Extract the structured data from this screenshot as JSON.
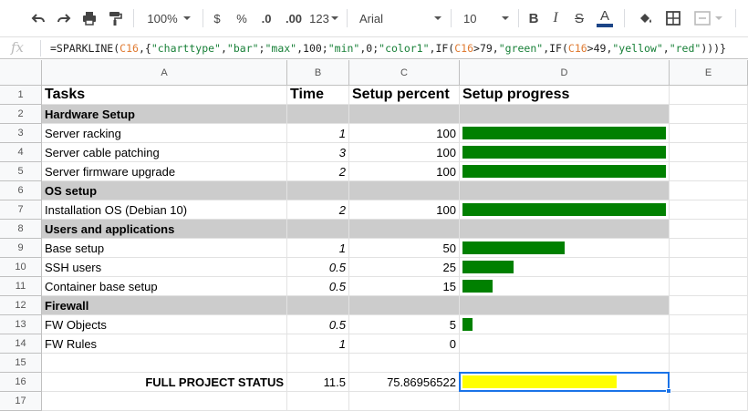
{
  "toolbar": {
    "zoom": "100%",
    "currency": "$",
    "percent": "%",
    "dec_decrease": ".0",
    "dec_increase": ".00",
    "more_formats": "123",
    "font": "Arial",
    "font_size": "10",
    "bold": "B",
    "italic": "I",
    "strike": "S",
    "text_color_letter": "A"
  },
  "formula_bar": {
    "fx": "fx",
    "formula_parts": [
      {
        "t": "=SPARKLINE(",
        "c": ""
      },
      {
        "t": "C16",
        "c": "ref"
      },
      {
        "t": ",{",
        "c": ""
      },
      {
        "t": "\"charttype\"",
        "c": "str"
      },
      {
        "t": ",",
        "c": ""
      },
      {
        "t": "\"bar\"",
        "c": "str"
      },
      {
        "t": ";",
        "c": ""
      },
      {
        "t": "\"max\"",
        "c": "str"
      },
      {
        "t": ",100;",
        "c": ""
      },
      {
        "t": "\"min\"",
        "c": "str"
      },
      {
        "t": ",0;",
        "c": ""
      },
      {
        "t": "\"color1\"",
        "c": "str"
      },
      {
        "t": ",IF(",
        "c": ""
      },
      {
        "t": "C16",
        "c": "ref"
      },
      {
        "t": ">79,",
        "c": ""
      },
      {
        "t": "\"green\"",
        "c": "str"
      },
      {
        "t": ",IF(",
        "c": ""
      },
      {
        "t": "C16",
        "c": "ref"
      },
      {
        "t": ">49,",
        "c": ""
      },
      {
        "t": "\"yellow\"",
        "c": "str"
      },
      {
        "t": ",",
        "c": ""
      },
      {
        "t": "\"red\"",
        "c": "str"
      },
      {
        "t": ")))}",
        "c": ""
      }
    ]
  },
  "columns": [
    "A",
    "B",
    "C",
    "D",
    "E"
  ],
  "rows": [
    {
      "n": "1",
      "type": "header",
      "a": "Tasks",
      "b": "Time",
      "c": "Setup percent",
      "d": "Setup progress"
    },
    {
      "n": "2",
      "type": "section",
      "a": "Hardware Setup"
    },
    {
      "n": "3",
      "type": "task",
      "a": "Server racking",
      "b": "1",
      "c": "100",
      "progress": 100,
      "color": "#008000"
    },
    {
      "n": "4",
      "type": "task",
      "a": "Server cable patching",
      "b": "3",
      "c": "100",
      "progress": 100,
      "color": "#008000"
    },
    {
      "n": "5",
      "type": "task",
      "a": "Server firmware upgrade",
      "b": "2",
      "c": "100",
      "progress": 100,
      "color": "#008000"
    },
    {
      "n": "6",
      "type": "section",
      "a": "OS setup"
    },
    {
      "n": "7",
      "type": "task",
      "a": "Installation OS (Debian 10)",
      "b": "2",
      "c": "100",
      "progress": 100,
      "color": "#008000"
    },
    {
      "n": "8",
      "type": "section",
      "a": "Users and applications"
    },
    {
      "n": "9",
      "type": "task",
      "a": "Base setup",
      "b": "1",
      "c": "50",
      "progress": 50,
      "color": "#008000"
    },
    {
      "n": "10",
      "type": "task",
      "a": "SSH users",
      "b": "0.5",
      "c": "25",
      "progress": 25,
      "color": "#008000"
    },
    {
      "n": "11",
      "type": "task",
      "a": "Container base setup",
      "b": "0.5",
      "c": "15",
      "progress": 15,
      "color": "#008000"
    },
    {
      "n": "12",
      "type": "section",
      "a": "Firewall"
    },
    {
      "n": "13",
      "type": "task",
      "a": "FW Objects",
      "b": "0.5",
      "c": "5",
      "progress": 5,
      "color": "#008000"
    },
    {
      "n": "14",
      "type": "task",
      "a": "FW Rules",
      "b": "1",
      "c": "0",
      "progress": 0,
      "color": "#008000"
    },
    {
      "n": "15",
      "type": "empty"
    },
    {
      "n": "16",
      "type": "status",
      "a": "FULL PROJECT STATUS",
      "b": "11.5",
      "c": "75.86956522",
      "progress": 75.86956522,
      "color": "#ffff00"
    },
    {
      "n": "17",
      "type": "empty"
    }
  ]
}
